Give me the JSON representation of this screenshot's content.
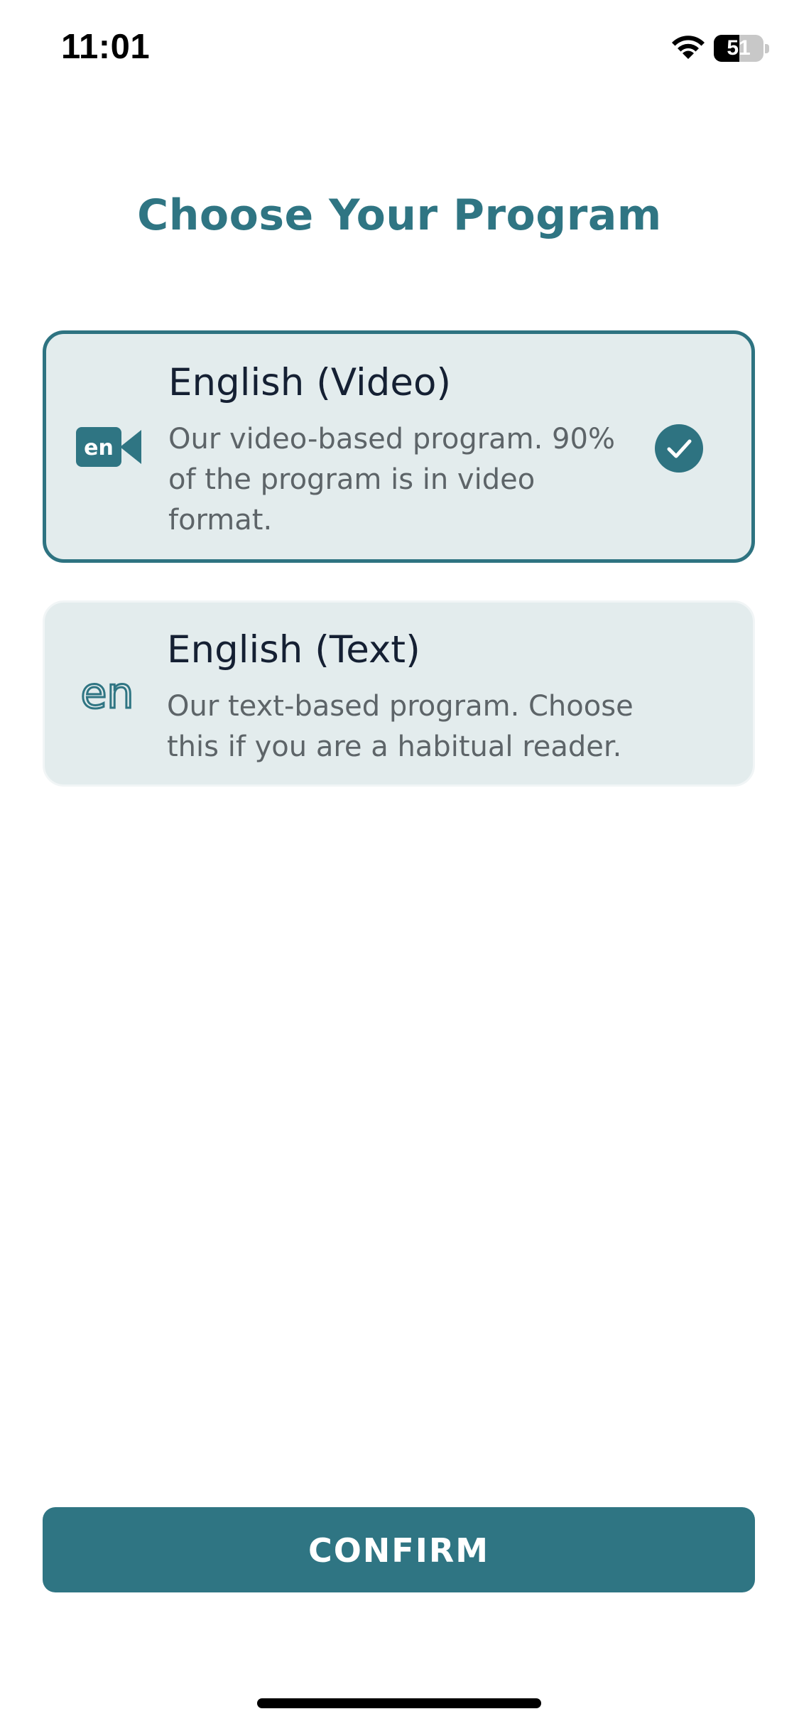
{
  "status_bar": {
    "time": "11:01",
    "battery_level": "51",
    "icons": [
      "wifi-icon",
      "battery-icon"
    ]
  },
  "page": {
    "title": "Choose Your Program"
  },
  "programs": [
    {
      "title": "English (Video)",
      "description": "Our video-based program. 90% of the program is in video format.",
      "icon": "en-video-icon",
      "selected": true
    },
    {
      "title": "English (Text)",
      "description": "Our text-based program. Choose this if you are a habitual reader.",
      "icon": "en-text-icon",
      "selected": false
    }
  ],
  "confirm_label": "CONFIRM",
  "colors": {
    "accent": "#2f7583",
    "card_background": "#e3eced",
    "title_text": "#152033",
    "body_text": "#5d6468",
    "battery_fill_fraction": 0.51
  }
}
